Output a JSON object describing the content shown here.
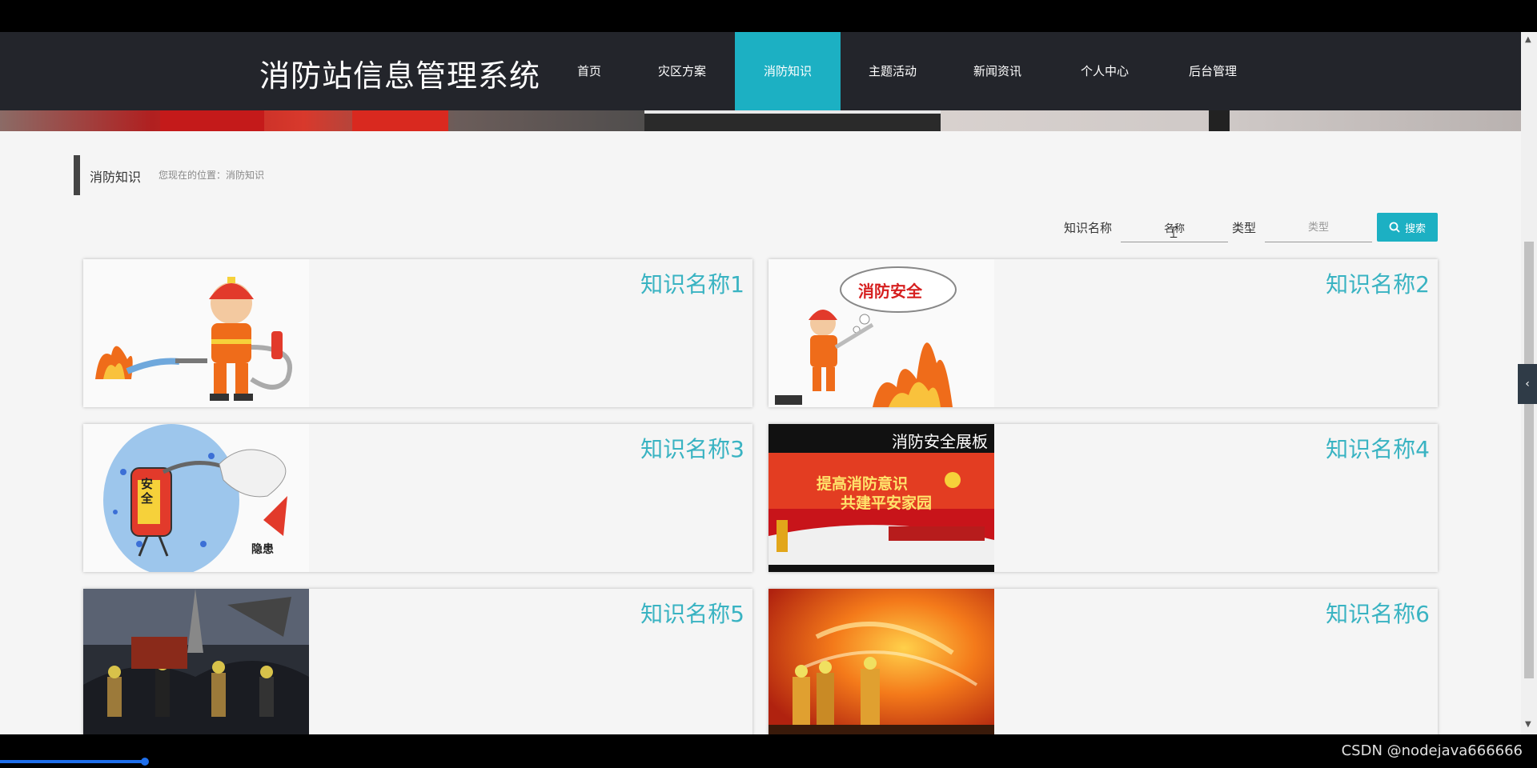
{
  "site": {
    "title": "消防站信息管理系统"
  },
  "nav": {
    "items": [
      {
        "label": "首页",
        "active": false
      },
      {
        "label": "灾区方案",
        "active": false
      },
      {
        "label": "消防知识",
        "active": true
      },
      {
        "label": "主题活动",
        "active": false
      },
      {
        "label": "新闻资讯",
        "active": false
      },
      {
        "label": "个人中心",
        "active": false
      },
      {
        "label": "后台管理",
        "active": false
      }
    ]
  },
  "breadcrumb": {
    "title": "消防知识",
    "path": "您现在的位置：消防知识"
  },
  "search": {
    "name_label": "知识名称",
    "name_value": "名称",
    "type_label": "类型",
    "type_placeholder": "类型",
    "button_label": "搜索"
  },
  "cards": [
    {
      "title": "知识名称1",
      "image": "firefighter-extinguishing-cartoon"
    },
    {
      "title": "知识名称2",
      "image": "fire-safety-cartoon",
      "image_text": "消防安全"
    },
    {
      "title": "知识名称3",
      "image": "extinguisher-hazard-cartoon",
      "image_text_a": "安全",
      "image_text_b": "隐患"
    },
    {
      "title": "知识名称4",
      "image": "fire-safety-poster",
      "image_text_a": "消防安全展板",
      "image_text_b": "提高消防意识",
      "image_text_c": "共建平安家园"
    },
    {
      "title": "知识名称5",
      "image": "firefighters-at-scene-photo"
    },
    {
      "title": "知识名称6",
      "image": "firefighters-in-flames-photo"
    }
  ],
  "watermark": "CSDN @nodejava666666",
  "colors": {
    "header_bg": "#23252b",
    "accent": "#1cb0c3",
    "card_title": "#39b3c2",
    "page_bg": "#f5f5f5"
  },
  "icons": {
    "search_button": "search-icon",
    "side_tab": "chevron-left-icon"
  }
}
